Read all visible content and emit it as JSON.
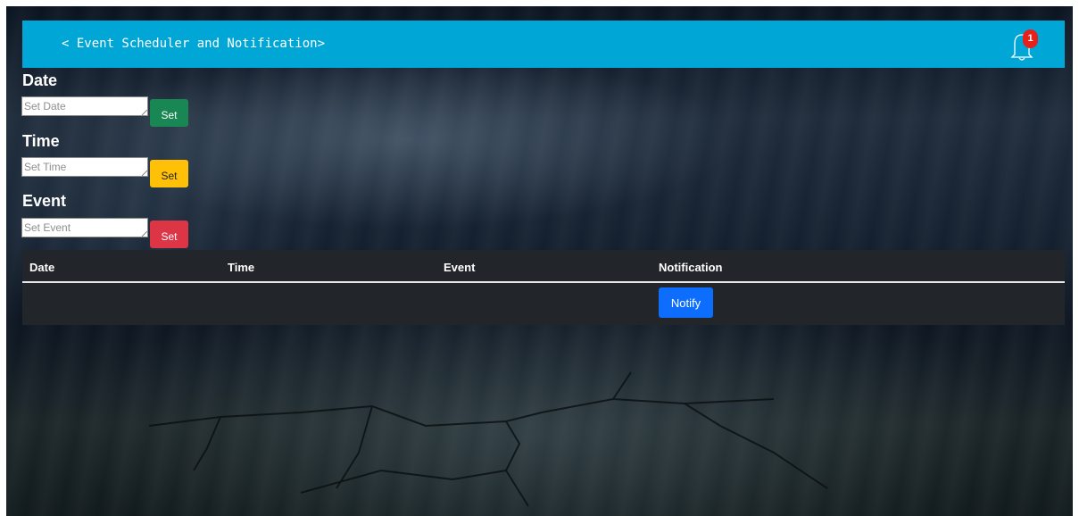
{
  "navbar": {
    "brand": "< Event Scheduler and Notification>",
    "notification_count": "1"
  },
  "form": {
    "date": {
      "label": "Date",
      "placeholder": "Set Date",
      "button": "Set"
    },
    "time": {
      "label": "Time",
      "placeholder": "Set Time",
      "button": "Set"
    },
    "event": {
      "label": "Event",
      "placeholder": "Set Event",
      "button": "Set"
    }
  },
  "table": {
    "headers": [
      "Date",
      "Time",
      "Event",
      "Notification"
    ],
    "rows": [
      {
        "date": "",
        "time": "",
        "event": "",
        "notify_label": "Notify"
      }
    ]
  },
  "colors": {
    "navbar": "#00a6d6",
    "date_set": "#198754",
    "time_set": "#ffc107",
    "event_set": "#dc3545",
    "notify": "#0d6efd",
    "badge": "#e6201a",
    "table_bg": "#22262b"
  },
  "icons": {
    "notification": "bell-icon"
  }
}
